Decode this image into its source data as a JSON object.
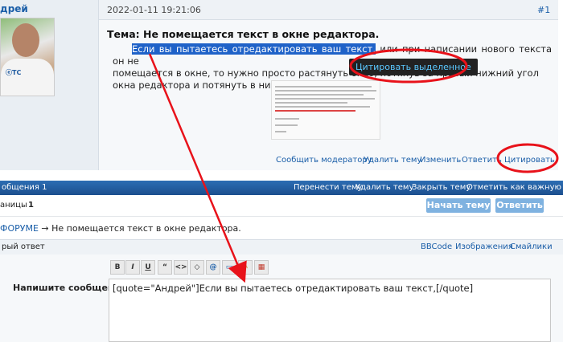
{
  "user": {
    "name": "дрей"
  },
  "post": {
    "date": "2022-01-11 19:21:06",
    "number": "#1",
    "title": "Тема: Не помещается текст в окне редактора.",
    "selected_text": "Если вы пытаетесь отредактировать ваш текст,",
    "body_rest_1": " или при написании нового текста он не",
    "body_line2": "помещается в окне, то нужно просто растянуть окно, потянув за правый нижний угол",
    "body_line3": "окна редактора и потянуть в низ.",
    "tooltip": "Цитировать выделенное",
    "actions": {
      "report": "Сообщить модератору",
      "delete": "Удалить тему",
      "edit": "Изменить",
      "reply": "Ответить",
      "quote": "Цитировать"
    }
  },
  "topic_bar": {
    "left": "общения 1",
    "move": "Перенести тему",
    "delete": "Удалить тему",
    "close": "Закрыть тему",
    "mark": "Отметить как важную"
  },
  "pages": {
    "label": "аницы",
    "value": "1",
    "new_topic": "Начать тему",
    "reply": "Ответить"
  },
  "breadcrumb": {
    "link": "ФОРУМЕ",
    "arrow": "→",
    "current": "Не помещается текст в окне редактора."
  },
  "quick_reply": {
    "title": "рый ответ",
    "bbcode": "BBCode",
    "images": "Изображения",
    "smilies": "Смайлики",
    "toolbar": [
      "B",
      "I",
      "U",
      "“",
      "<>",
      "◇",
      "@",
      "▭",
      "✎",
      "▦"
    ],
    "message_label": "Напишите сообщение",
    "message_value": "[quote=\"Андрей\"]Если вы пытаетесь отредактировать ваш текст,[/quote]"
  },
  "colors": {
    "link": "#1a5ea8",
    "bar": "#1c4f8e",
    "annotation": "#e8121a",
    "highlight": "#1f62c8"
  }
}
